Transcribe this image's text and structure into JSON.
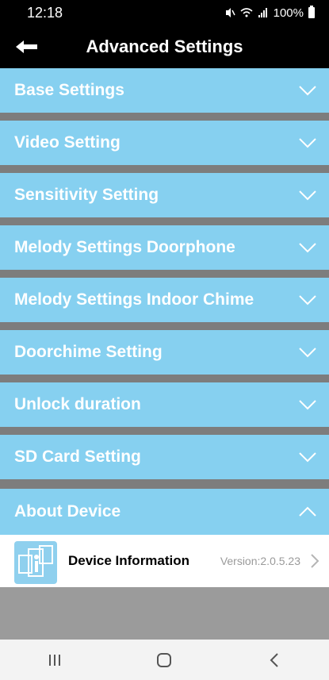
{
  "status_bar": {
    "time": "12:18",
    "battery": "100%"
  },
  "header": {
    "title": "Advanced Settings",
    "back_icon": "back-arrow-icon"
  },
  "sections": [
    {
      "label": "Base Settings",
      "state": "collapsed"
    },
    {
      "label": "Video Setting",
      "state": "collapsed"
    },
    {
      "label": "Sensitivity Setting",
      "state": "collapsed"
    },
    {
      "label": "Melody Settings Doorphone",
      "state": "collapsed"
    },
    {
      "label": "Melody Settings Indoor Chime",
      "state": "collapsed"
    },
    {
      "label": "Doorchime Setting",
      "state": "collapsed"
    },
    {
      "label": "Unlock duration",
      "state": "collapsed"
    },
    {
      "label": "SD Card Setting",
      "state": "collapsed"
    },
    {
      "label": "About Device",
      "state": "expanded"
    }
  ],
  "device_info": {
    "label": "Device Information",
    "version": "Version:2.0.5.23"
  },
  "colors": {
    "section_bg": "#86d0f0",
    "divider": "#7d7d7d",
    "header_bg": "#000000"
  }
}
